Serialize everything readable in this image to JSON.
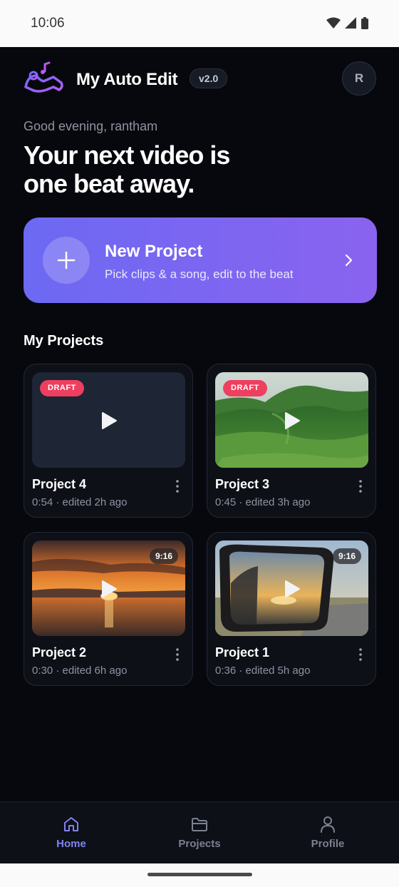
{
  "status_bar": {
    "time": "10:06"
  },
  "header": {
    "app_title": "My Auto Edit",
    "version": "v2.0",
    "avatar_initial": "R"
  },
  "hero": {
    "greeting": "Good evening, rantham",
    "headline_line1": "Your next video is",
    "headline_line2": "one beat away."
  },
  "new_project": {
    "title": "New Project",
    "subtitle": "Pick clips & a song, edit to the beat"
  },
  "projects_section": {
    "title": "My Projects"
  },
  "projects": [
    {
      "title": "Project 4",
      "meta": "0:54 · edited 2h ago",
      "badge": "DRAFT",
      "thumbnail": "blank-dark"
    },
    {
      "title": "Project 3",
      "meta": "0:45 · edited 3h ago",
      "badge": "DRAFT",
      "thumbnail": "green-mountains"
    },
    {
      "title": "Project 2",
      "meta": "0:30 · edited 6h ago",
      "badge": "9:16",
      "thumbnail": "sunset-sea"
    },
    {
      "title": "Project 1",
      "meta": "0:36 · edited 5h ago",
      "badge": "9:16",
      "thumbnail": "car-side-mirror"
    }
  ],
  "bottom_nav": [
    {
      "label": "Home",
      "icon": "home-icon",
      "active": true
    },
    {
      "label": "Projects",
      "icon": "folder-icon",
      "active": false
    },
    {
      "label": "Profile",
      "icon": "person-icon",
      "active": false
    }
  ],
  "colors": {
    "accent": "#8183f2",
    "gradient_start": "#6c69f3",
    "gradient_end": "#8a63ef",
    "draft_badge": "#ef3f5f",
    "background": "#07080d"
  }
}
